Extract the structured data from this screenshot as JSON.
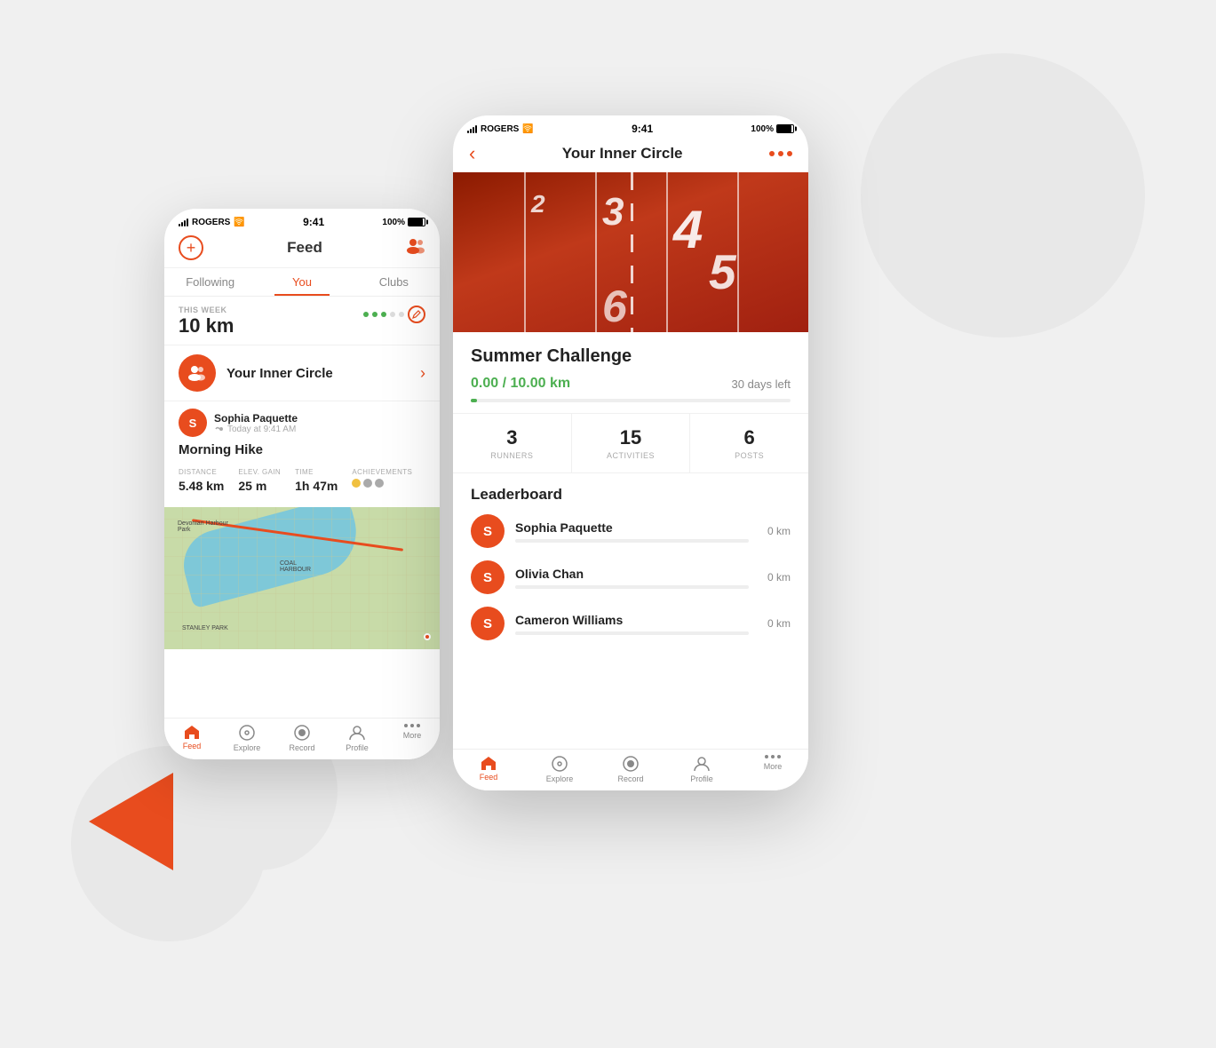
{
  "background": {
    "color": "#f0f0f0"
  },
  "phone_back": {
    "status_bar": {
      "carrier": "ROGERS",
      "time": "9:41",
      "battery": "100%"
    },
    "nav_header": {
      "title": "Feed"
    },
    "tabs": [
      {
        "label": "Following",
        "active": false
      },
      {
        "label": "You",
        "active": true
      },
      {
        "label": "Clubs",
        "active": false
      }
    ],
    "week_stats": {
      "label": "THIS WEEK",
      "value": "10 km"
    },
    "inner_circle": {
      "label": "Your Inner Circle"
    },
    "activity": {
      "user_name": "Sophia Paquette",
      "time": "Today at 9:41 AM",
      "title": "Morning Hike",
      "distance_label": "Distance",
      "distance_val": "5.48 km",
      "elev_label": "Elev. Gain",
      "elev_val": "25 m",
      "time_label": "Time",
      "time_val": "1h 47m",
      "achievements_label": "Achievements"
    },
    "bottom_nav": {
      "items": [
        {
          "label": "Feed",
          "active": true
        },
        {
          "label": "Explore",
          "active": false
        },
        {
          "label": "Record",
          "active": false
        },
        {
          "label": "Profile",
          "active": false
        },
        {
          "label": "More",
          "active": false
        }
      ]
    }
  },
  "phone_front": {
    "status_bar": {
      "carrier": "ROGERS",
      "time": "9:41",
      "battery": "100%"
    },
    "top_nav": {
      "title": "Your Inner Circle",
      "back_label": "‹"
    },
    "challenge": {
      "title": "Summer Challenge",
      "progress_current": "0.00",
      "progress_total": "10.00 km",
      "days_left": "30 days left"
    },
    "stats": [
      {
        "num": "3",
        "label": "RUNNERS"
      },
      {
        "num": "15",
        "label": "ACTIVITIES"
      },
      {
        "num": "6",
        "label": "POSTS"
      }
    ],
    "leaderboard": {
      "title": "Leaderboard",
      "items": [
        {
          "name": "Sophia Paquette",
          "initial": "S",
          "km": "0 km"
        },
        {
          "name": "Olivia Chan",
          "initial": "S",
          "km": "0 km"
        },
        {
          "name": "Cameron Williams",
          "initial": "S",
          "km": "0 km"
        }
      ]
    },
    "bottom_nav": {
      "items": [
        {
          "label": "Feed",
          "active": true
        },
        {
          "label": "Explore",
          "active": false
        },
        {
          "label": "Record",
          "active": false
        },
        {
          "label": "Profile",
          "active": false
        },
        {
          "label": "More",
          "active": false
        }
      ]
    }
  }
}
